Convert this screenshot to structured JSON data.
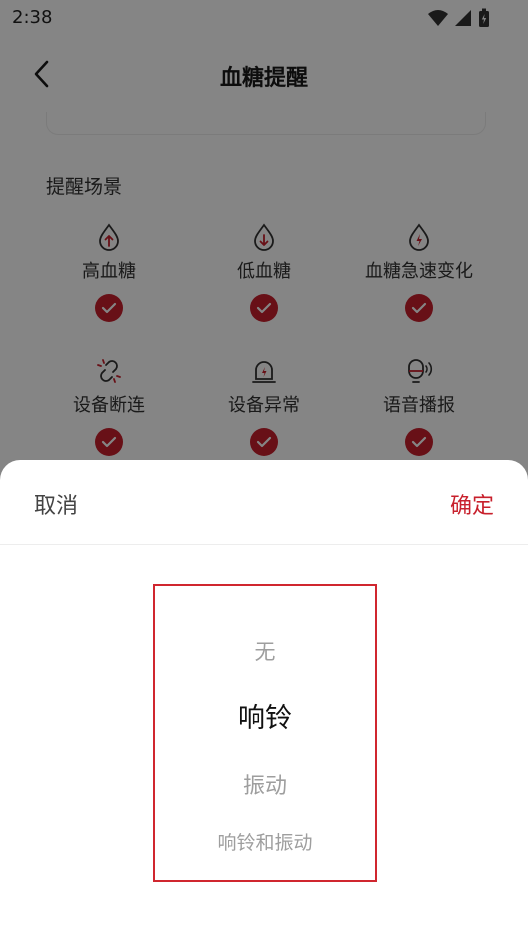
{
  "status_bar": {
    "time": "2:38"
  },
  "header": {
    "title": "血糖提醒"
  },
  "section": {
    "label": "提醒场景"
  },
  "scenes": [
    {
      "label": "高血糖",
      "icon": "drop-up-arrow-icon"
    },
    {
      "label": "低血糖",
      "icon": "drop-down-arrow-icon"
    },
    {
      "label": "血糖急速变化",
      "icon": "drop-bolt-icon"
    },
    {
      "label": "设备断连",
      "icon": "broken-link-icon"
    },
    {
      "label": "设备异常",
      "icon": "device-alert-icon"
    },
    {
      "label": "语音播报",
      "icon": "speaker-voice-icon"
    }
  ],
  "sheet": {
    "cancel": "取消",
    "confirm": "确定",
    "options": [
      "无",
      "响铃",
      "振动",
      "响铃和振动"
    ],
    "selected": "响铃"
  },
  "colors": {
    "accent": "#c8202c",
    "picker_border": "#d0262f"
  }
}
